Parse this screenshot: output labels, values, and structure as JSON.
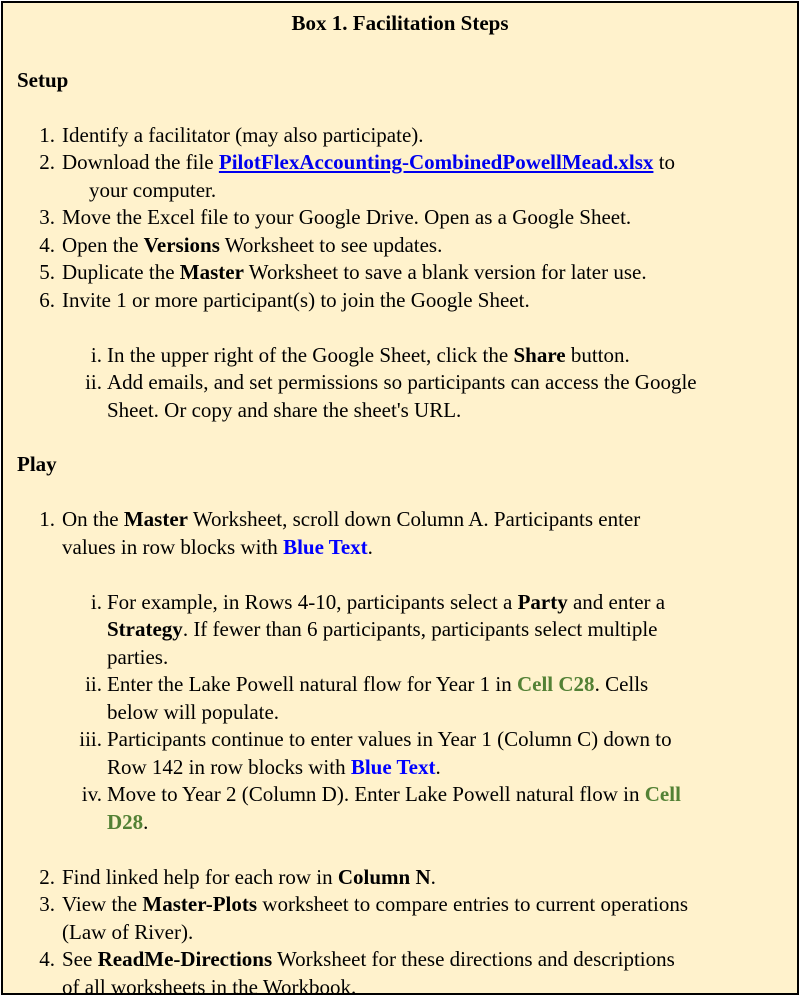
{
  "title": "Box 1. Facilitation Steps",
  "setup": {
    "heading": "Setup",
    "items": [
      {
        "num": "1.",
        "text": "Identify a facilitator (may also participate)."
      },
      {
        "num": "2.",
        "pre": "Download the file ",
        "link": "PilotFlexAccounting-CombinedPowellMead.xlsx",
        "post": " to",
        "cont": "your computer."
      },
      {
        "num": "3.",
        "text": "Move the Excel file to your Google Drive. Open as a Google Sheet."
      },
      {
        "num": "4.",
        "pre": "Open the ",
        "bold": "Versions",
        "post": " Worksheet to see updates."
      },
      {
        "num": "5.",
        "pre": "Duplicate the ",
        "bold": "Master",
        "post": " Worksheet to save a blank version for later use."
      },
      {
        "num": "6.",
        "text": "Invite 1 or more participant(s) to join the Google Sheet."
      }
    ],
    "subitems": [
      {
        "num": "i.",
        "pre": "In the upper right of the Google Sheet, click the ",
        "bold": "Share",
        "post": " button."
      },
      {
        "num": "ii.",
        "text1": "Add emails, and set permissions so participants can access the Google",
        "text2": "Sheet. Or copy and share the sheet's URL."
      }
    ]
  },
  "play": {
    "heading": "Play",
    "item1": {
      "num": "1.",
      "pre": "On the ",
      "bold": "Master",
      "mid": " Worksheet, scroll down Column A. Participants enter",
      "line2": "values in row blocks with ",
      "blue": "Blue Text",
      "end": "."
    },
    "subitems": [
      {
        "num": "i.",
        "l1a": "For example, in Rows 4-10, participants select a ",
        "l1b": "Party",
        "l1c": " and enter a",
        "l2a": "Strategy",
        "l2b": ". If fewer than 6 participants, participants select multiple",
        "l3": "parties."
      },
      {
        "num": "ii.",
        "l1a": "Enter the Lake Powell natural flow for Year 1 in ",
        "l1b": "Cell C28",
        "l1c": ". Cells",
        "l2": "below will populate."
      },
      {
        "num": "iii.",
        "l1": "Participants continue to enter values in Year 1 (Column C) down to",
        "l2a": "Row 142 in row blocks with ",
        "l2b": "Blue Text",
        "l2c": "."
      },
      {
        "num": "iv.",
        "l1a": "Move to Year 2 (Column D). Enter Lake Powell natural flow in ",
        "l1b": "Cell",
        "l2a": "D28",
        "l2b": "."
      }
    ],
    "items": [
      {
        "num": "2.",
        "pre": "Find linked help for each row in ",
        "bold": "Column N",
        "post": "."
      },
      {
        "num": "3.",
        "pre": "View the ",
        "bold": "Master-Plots",
        "post": " worksheet to compare entries to current operations",
        "line2": "(Law of River)."
      },
      {
        "num": "4.",
        "pre": "See ",
        "bold": "ReadMe-Directions",
        "post": " Worksheet for these directions and descriptions",
        "line2": "of all worksheets in the Workbook."
      }
    ]
  }
}
